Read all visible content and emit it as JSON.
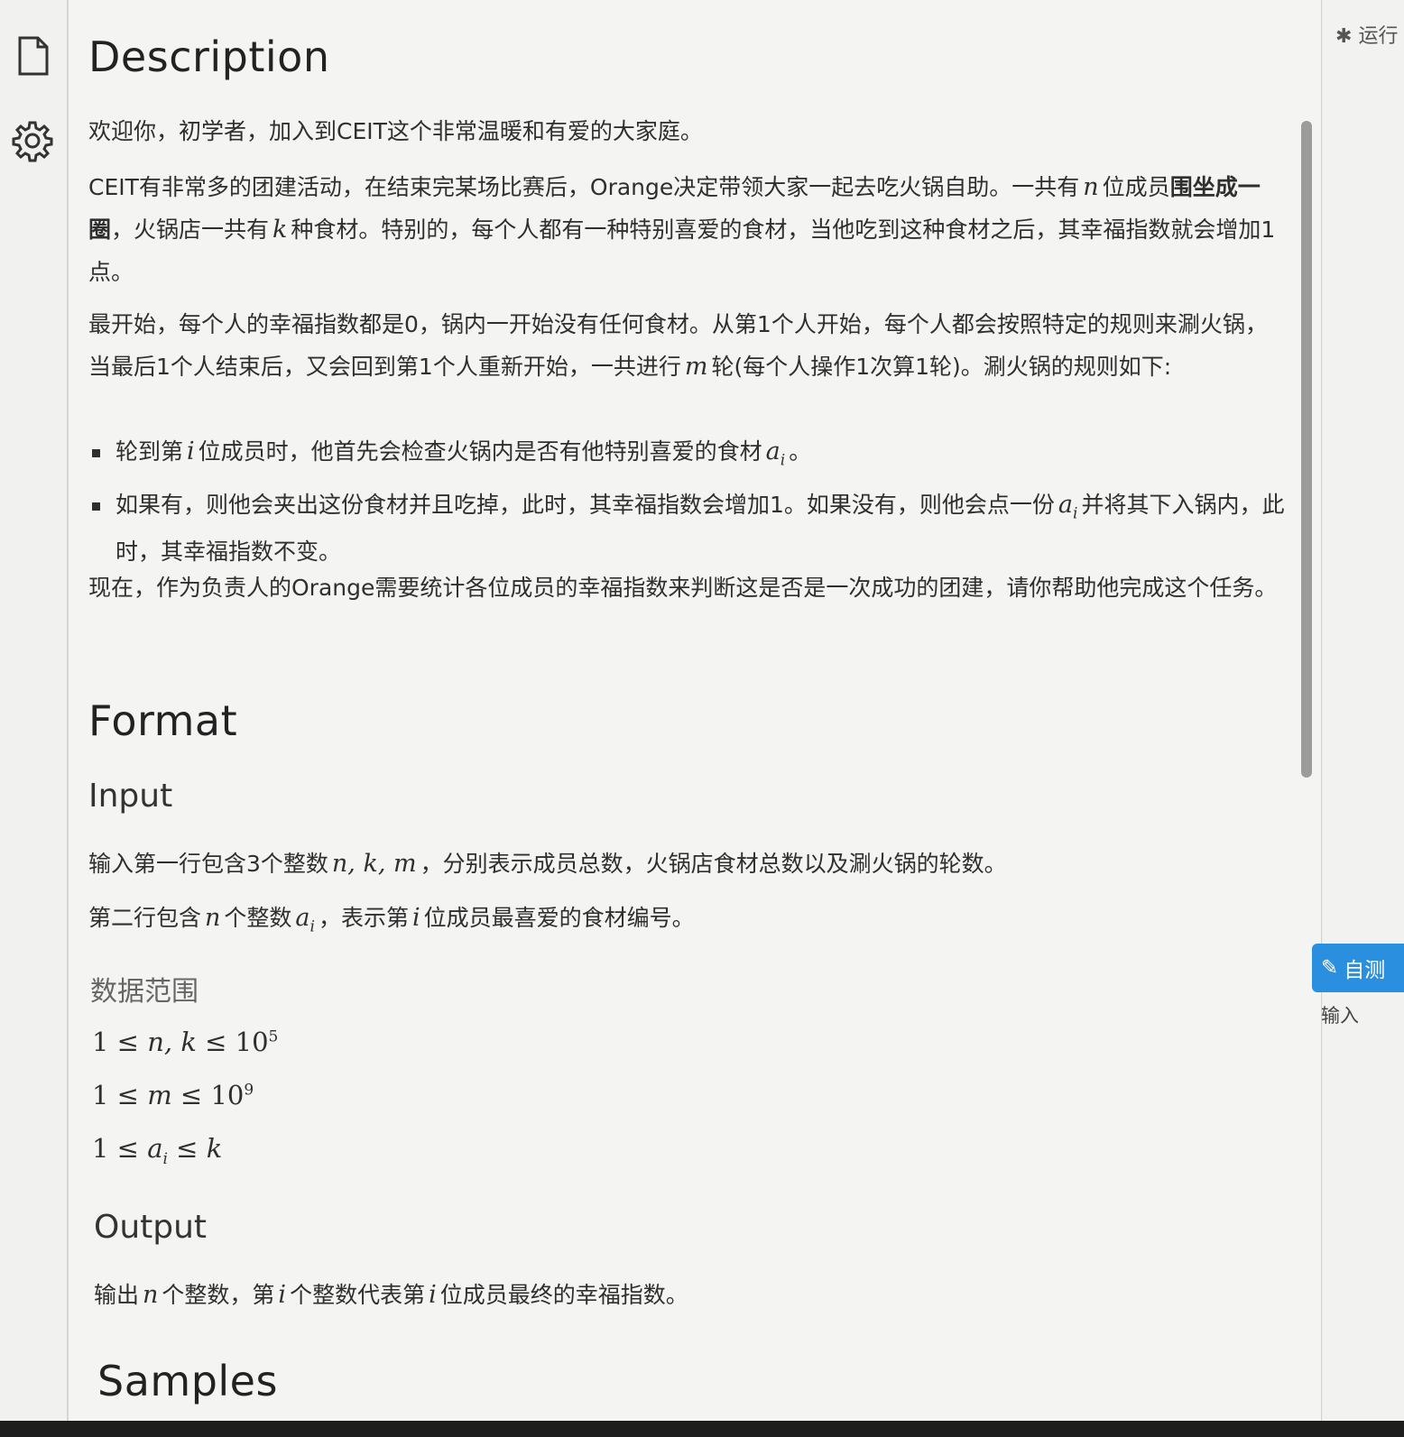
{
  "sidebar": {
    "icons": [
      "document-icon",
      "gear-icon"
    ]
  },
  "description": {
    "heading": "Description",
    "p1": "欢迎你，初学者，加入到CEIT这个非常温暖和有爱的大家庭。",
    "p2a": "CEIT有非常多的团建活动，在结束完某场比赛后，Orange决定带领大家一起去吃火锅自助。一共有",
    "p2b": "位成员",
    "p2bold": "围坐成一圈",
    "p2c": "，火锅店一共有",
    "p2d": "种食材。特别的，每个人都有一种特别喜爱的食材，当他吃到这种食材之后，其幸福指数就会增加1点。",
    "p3a": "最开始，每个人的幸福指数都是0，锅内一开始没有任何食材。从第1个人开始，每个人都会按照特定的规则来涮火锅，当最后1个人结束后，又会回到第1个人重新开始，一共进行",
    "p3b": "轮(每个人操作1次算1轮)。涮火锅的规则如下:",
    "b1a": "轮到第",
    "b1b": "位成员时，他首先会检查火锅内是否有他特别喜爱的食材",
    "b1c": "。",
    "b2a": "如果有，则他会夹出这份食材并且吃掉，此时，其幸福指数会增加1。如果没有，则他会点一份",
    "b2b": "并将其下入锅内，此时，其幸福指数不变。",
    "p4": "现在，作为负责人的Orange需要统计各位成员的幸福指数来判断这是否是一次成功的团建，请你帮助他完成这个任务。"
  },
  "format": {
    "heading": "Format",
    "input_heading": "Input",
    "in1a": "输入第一行包含3个整数",
    "in1b": "，分别表示成员总数，火锅店食材总数以及涮火锅的轮数。",
    "in2a": "第二行包含",
    "in2b": "个整数",
    "in2c": "，表示第",
    "in2d": "位成员最喜爱的食材编号。",
    "range_heading": "数据范围",
    "output_heading": "Output",
    "out1a": "输出",
    "out1b": "个整数，第",
    "out1c": "个整数代表第",
    "out1d": "位成员最终的幸福指数。"
  },
  "samples": {
    "heading": "Samples"
  },
  "math": {
    "n": "n",
    "k": "k",
    "m": "m",
    "i": "i",
    "a": "a",
    "nkm": "n, k, m",
    "le": "≤",
    "one": "1",
    "ten": "10",
    "exp5": "5",
    "exp9": "9",
    "comma_k": "n, k"
  },
  "right_panel": {
    "run_label": "运行",
    "selftest_label": "自测",
    "input_label": "输入"
  }
}
